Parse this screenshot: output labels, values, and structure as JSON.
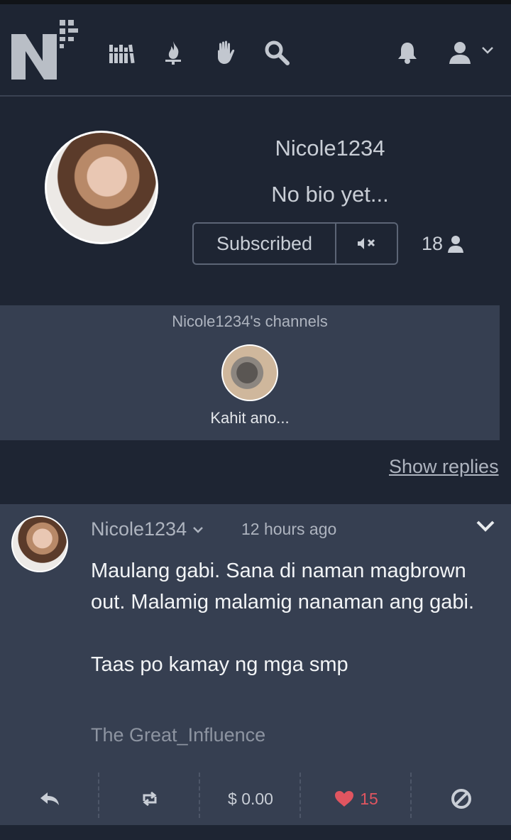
{
  "nav": {
    "logo_letter": "N",
    "icons": [
      "library-icon",
      "fire-icon",
      "hand-icon",
      "search-icon",
      "bell-icon",
      "user-icon",
      "chevron-down-icon"
    ]
  },
  "profile": {
    "username": "Nicole1234",
    "bio": "No bio yet...",
    "subscribe_label": "Subscribed",
    "mute_icon": "mute-icon",
    "subscriber_count": "18"
  },
  "channels": {
    "title": "Nicole1234's channels",
    "items": [
      {
        "name": "Kahit ano..."
      }
    ]
  },
  "show_replies_label": "Show replies",
  "post": {
    "author": "Nicole1234",
    "time": "12 hours ago",
    "body_line1": "Maulang gabi. Sana di naman magbrown out. Malamig malamig nanaman ang gabi.",
    "body_line2": "Taas po kamay ng mga smp",
    "reference": "The Great_Influence",
    "actions": {
      "tip_amount": "$ 0.00",
      "like_count": "15"
    }
  },
  "colors": {
    "background": "#1e2533",
    "panel": "#363f51",
    "like": "#e05560",
    "text_muted": "#aeb4bf"
  }
}
